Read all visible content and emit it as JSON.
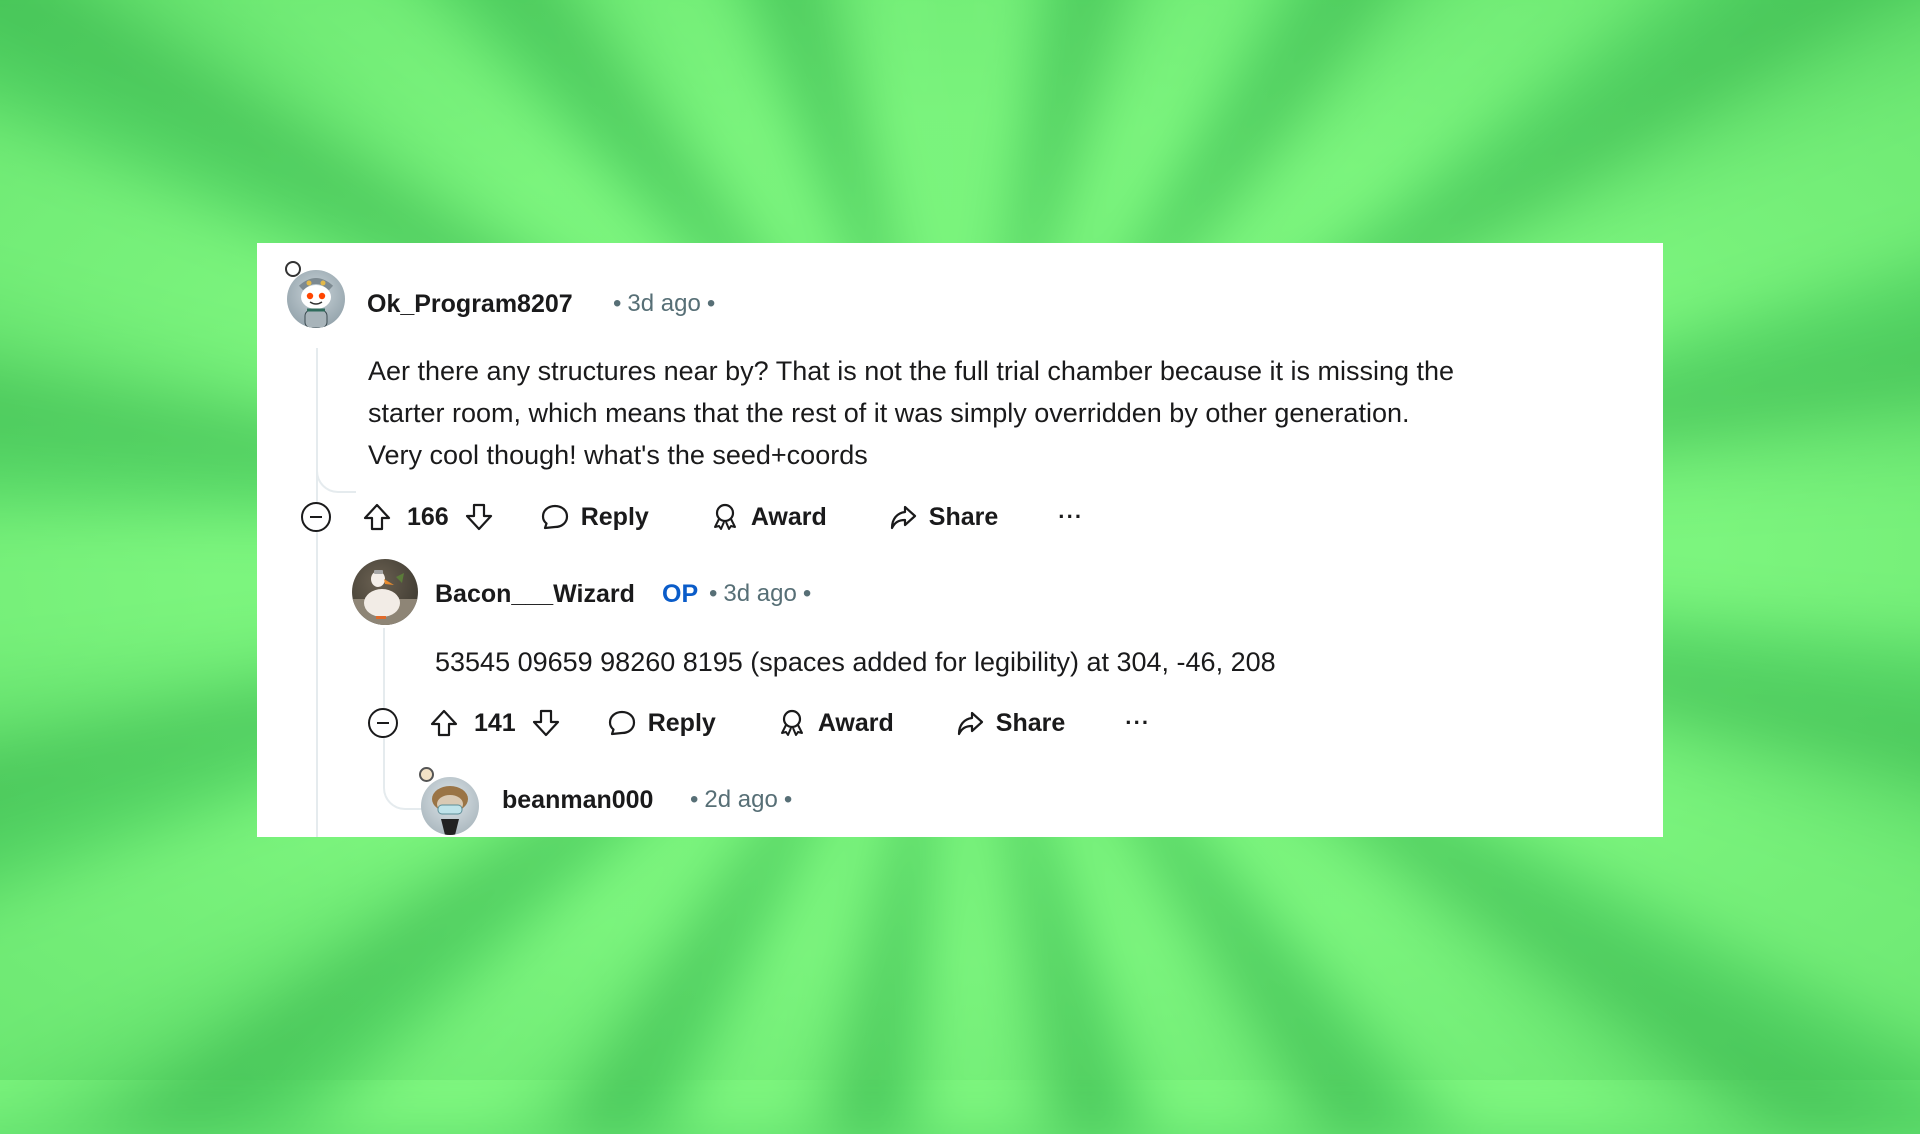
{
  "colors": {
    "background_green": "#62e06f",
    "card": "#ffffff",
    "text": "#1a1a1b",
    "meta_text": "#576f76",
    "op_badge": "#0a5cc9",
    "thread_line": "#e5ebee"
  },
  "comments": [
    {
      "username": "Ok_Program8207",
      "time": "3d ago",
      "avatar": "snoo-avatar-grey-hood",
      "body_lines": [
        "Aer there any structures near by? That is not the full trial chamber because it is missing the",
        "starter room, which means that the rest of it was simply overridden by other generation.",
        "Very cool though! what's the seed+coords"
      ],
      "votes": "166",
      "actions": {
        "reply": "Reply",
        "award": "Award",
        "share": "Share",
        "more": "···"
      }
    },
    {
      "username": "Bacon___Wizard",
      "badge": "OP",
      "time": "3d ago",
      "avatar": "duck-photo-avatar",
      "body_lines": [
        "53545 09659 98260 8195 (spaces added for legibility) at 304, -46, 208"
      ],
      "votes": "141",
      "actions": {
        "reply": "Reply",
        "award": "Award",
        "share": "Share",
        "more": "···"
      }
    },
    {
      "username": "beanman000",
      "time": "2d ago",
      "avatar": "snoo-avatar-masked"
    }
  ],
  "separator": "•"
}
